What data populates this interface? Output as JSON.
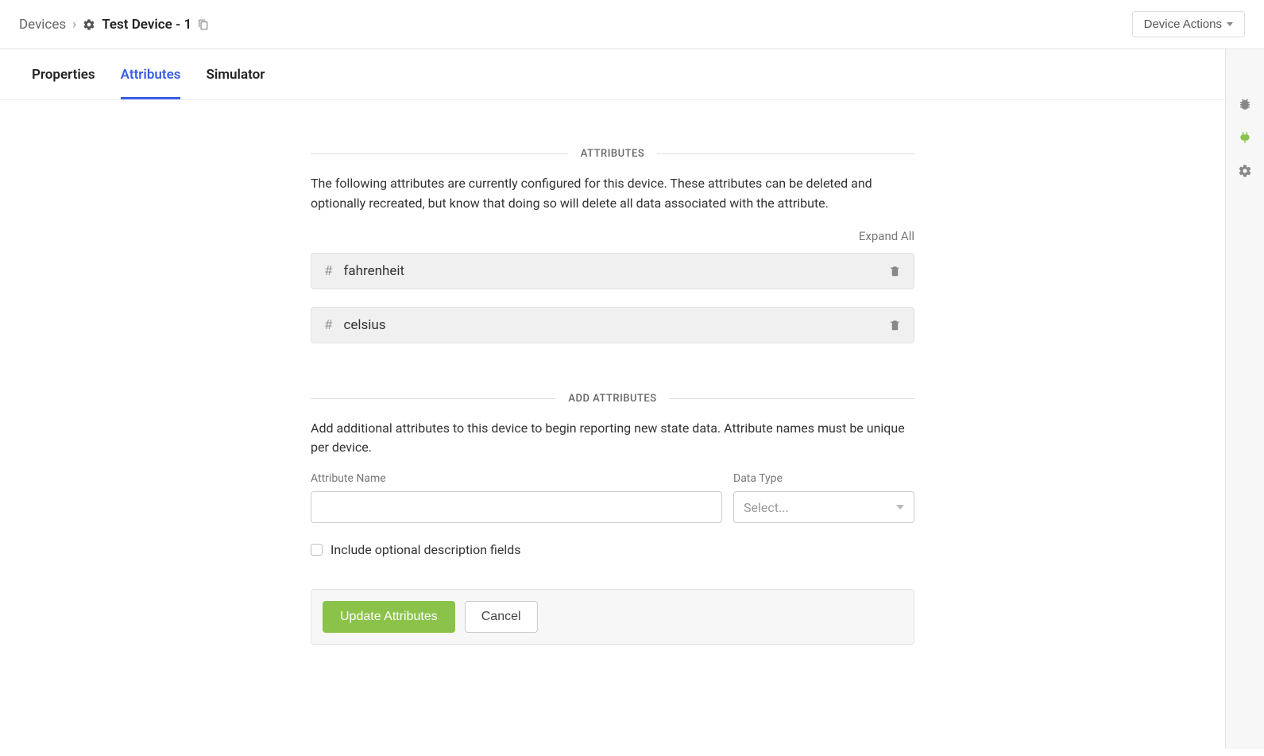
{
  "breadcrumb": {
    "root": "Devices",
    "current": "Test Device - 1"
  },
  "header": {
    "actions_label": "Device Actions"
  },
  "tabs": [
    {
      "label": "Properties",
      "active": false
    },
    {
      "label": "Attributes",
      "active": true
    },
    {
      "label": "Simulator",
      "active": false
    }
  ],
  "sections": {
    "attributes": {
      "heading": "ATTRIBUTES",
      "description": "The following attributes are currently configured for this device. These attributes can be deleted and optionally recreated, but know that doing so will delete all data associated with the attribute.",
      "expand_all": "Expand All",
      "rows": [
        {
          "name": "fahrenheit"
        },
        {
          "name": "celsius"
        }
      ]
    },
    "add": {
      "heading": "ADD ATTRIBUTES",
      "description": "Add additional attributes to this device to begin reporting new state data. Attribute names must be unique per device.",
      "name_label": "Attribute Name",
      "name_value": "",
      "type_label": "Data Type",
      "type_placeholder": "Select...",
      "include_optional": "Include optional description fields"
    }
  },
  "actions": {
    "primary": "Update Attributes",
    "secondary": "Cancel"
  },
  "rail_icons": [
    "bug-icon",
    "plug-icon",
    "device-gear-icon"
  ]
}
